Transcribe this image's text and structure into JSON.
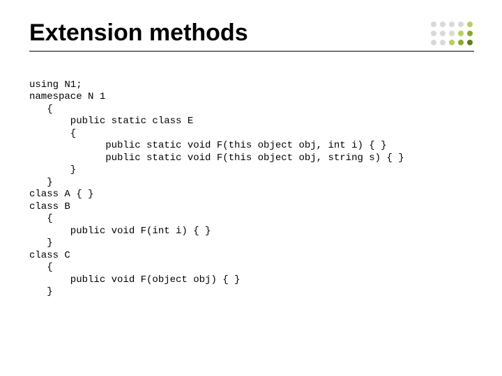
{
  "title": "Extension methods",
  "dot_colors": [
    "#d9d9d9",
    "#d9d9d9",
    "#d9d9d9",
    "#d9d9d9",
    "#b7cf63",
    "#d9d9d9",
    "#d9d9d9",
    "#d9d9d9",
    "#b7cf63",
    "#8aa82e",
    "#d9d9d9",
    "#d9d9d9",
    "#b7cf63",
    "#8aa82e",
    "#5f7f1c"
  ],
  "code": {
    "l01": "using N1;",
    "l02": "namespace N 1",
    "l03": "   {",
    "l04": "       public static class E",
    "l05": "       {",
    "l06": "             public static void F(this object obj, int i) { }",
    "l07": "             public static void F(this object obj, string s) { }",
    "l08": "       }",
    "l09": "   }",
    "l10": "class A { }",
    "l11": "class B",
    "l12": "   {",
    "l13": "       public void F(int i) { }",
    "l14": "   }",
    "l15": "class C",
    "l16": "   {",
    "l17": "       public void F(object obj) { }",
    "l18": "   }"
  }
}
